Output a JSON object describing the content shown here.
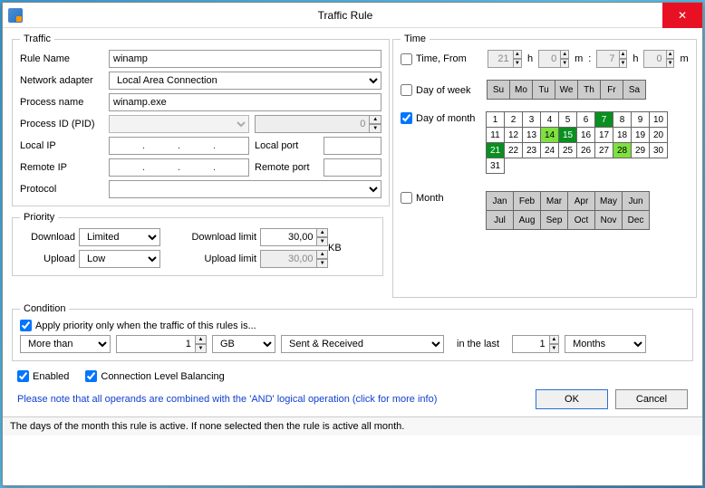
{
  "window": {
    "title": "Traffic Rule"
  },
  "traffic": {
    "legend": "Traffic",
    "fields": {
      "rule_name": {
        "label": "Rule Name",
        "value": "winamp"
      },
      "network_adapter": {
        "label": "Network adapter",
        "value": "Local Area Connection"
      },
      "process_name": {
        "label": "Process name",
        "value": "winamp.exe"
      },
      "process_id": {
        "label": "Process ID (PID)",
        "value": "",
        "spin_value": "0"
      },
      "local_ip": {
        "label": "Local IP",
        "port_label": "Local port",
        "port_value": ""
      },
      "remote_ip": {
        "label": "Remote IP",
        "port_label": "Remote port",
        "port_value": ""
      },
      "protocol": {
        "label": "Protocol",
        "value": ""
      }
    }
  },
  "priority": {
    "legend": "Priority",
    "download": {
      "label": "Download",
      "value": "Limited",
      "limit_label": "Download limit",
      "limit_value": "30,00"
    },
    "upload": {
      "label": "Upload",
      "value": "Low",
      "limit_label": "Upload limit",
      "limit_value": "30,00"
    },
    "unit": "KB"
  },
  "time": {
    "legend": "Time",
    "from": {
      "label": "Time, From",
      "h1": "21",
      "m1": "0",
      "h2": "7",
      "m2": "0",
      "hs": "h",
      "ms": "m",
      "sep": ":"
    },
    "dow": {
      "label": "Day of week",
      "days": [
        "Su",
        "Mo",
        "Tu",
        "We",
        "Th",
        "Fr",
        "Sa"
      ]
    },
    "dom": {
      "label": "Day of month",
      "selected_primary": [
        7,
        15,
        21
      ],
      "selected_secondary": [
        14,
        28
      ],
      "count": 31
    },
    "month": {
      "label": "Month",
      "months": [
        "Jan",
        "Feb",
        "Mar",
        "Apr",
        "May",
        "Jun",
        "Jul",
        "Aug",
        "Sep",
        "Oct",
        "Nov",
        "Dec"
      ]
    }
  },
  "condition": {
    "legend": "Condition",
    "apply_label": "Apply priority only when the traffic of this rules is...",
    "operator": "More than",
    "amount": "1",
    "unit": "GB",
    "direction": "Sent & Received",
    "in_last": "in the last",
    "period_amount": "1",
    "period_unit": "Months"
  },
  "footer": {
    "enabled": "Enabled",
    "clb": "Connection Level Balancing",
    "note": "Please note that all operands are combined with the 'AND' logical operation (click for more info)",
    "ok": "OK",
    "cancel": "Cancel"
  },
  "status": "The days of the month this rule is active. If none selected then the rule is active all month."
}
